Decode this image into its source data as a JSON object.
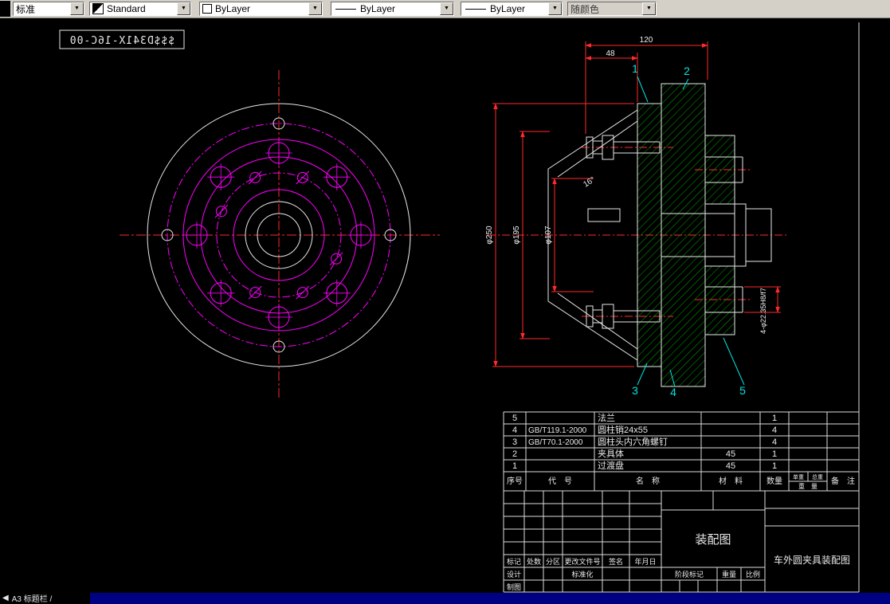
{
  "toolbar": {
    "combos": [
      {
        "label": "标准"
      },
      {
        "label": "Standard"
      },
      {
        "label": "ByLayer"
      },
      {
        "label": "ByLayer"
      },
      {
        "label": "ByLayer"
      },
      {
        "label": "随颜色"
      }
    ]
  },
  "icons": {
    "chevron_down": "▼",
    "tab_arrow": "◀"
  },
  "drawing": {
    "mirrored_label": "$$$D341X-16C-00",
    "dimensions": {
      "width_total": "120",
      "width_step": "48",
      "dia_outer": "φ250",
      "dia_bolt": "φ195",
      "dia_bore": "φ107",
      "taper_angle": "16°",
      "holes_note": "4-φ22.35H8/f7"
    },
    "balloons": [
      "1",
      "2",
      "3",
      "4",
      "5"
    ],
    "colors": {
      "outline": "#e8e8e8",
      "geometry": "#ff00ff",
      "centerline": "#ff2a2a",
      "dimension": "#ff2a2a",
      "hatch": "#00aa00",
      "balloon": "#00e5e5"
    }
  },
  "bom": {
    "header": {
      "seq": "序号",
      "code": "代　号",
      "name": "名　称",
      "material": "材　料",
      "qty": "数量",
      "weight_unit": "单重",
      "weight_total": "总重",
      "weight": "重　量",
      "remark": "备　注"
    },
    "rows": [
      {
        "seq": "5",
        "code": "",
        "name": "法兰",
        "material": "",
        "qty": "1"
      },
      {
        "seq": "4",
        "code": "GB/T119.1-2000",
        "name": "圆柱销24x55",
        "material": "",
        "qty": "4"
      },
      {
        "seq": "3",
        "code": "GB/T70.1-2000",
        "name": "圆柱头内六角螺钉",
        "material": "",
        "qty": "4"
      },
      {
        "seq": "2",
        "code": "",
        "name": "夹具体",
        "material": "45",
        "qty": "1"
      },
      {
        "seq": "1",
        "code": "",
        "name": "过渡盘",
        "material": "45",
        "qty": "1"
      }
    ]
  },
  "title_block": {
    "revision_headers": [
      "标记",
      "处数",
      "分区",
      "更改文件号",
      "签名",
      "年月日"
    ],
    "design_label": "设计",
    "draft_label": "制图",
    "standardization_label": "标准化",
    "stage_mark_label": "阶段标记",
    "weight_label": "重量",
    "scale_label": "比例",
    "drawing_type": "装配图",
    "drawing_title": "车外圆夹具装配图"
  },
  "status": {
    "tab": "A3 标题栏 /"
  }
}
